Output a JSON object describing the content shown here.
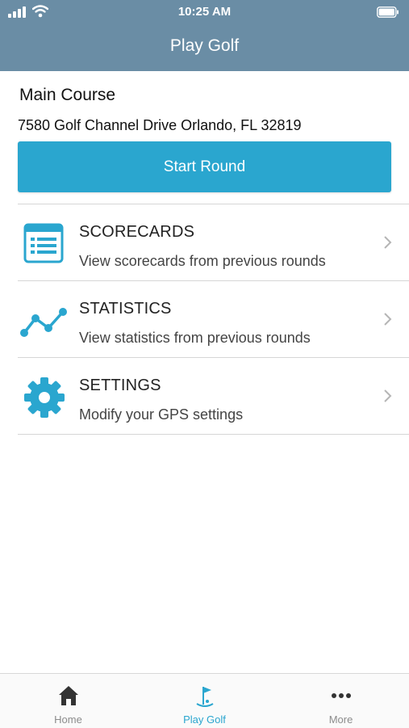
{
  "status_bar": {
    "time": "10:25 AM"
  },
  "header": {
    "title": "Play Golf"
  },
  "course": {
    "name": "Main Course",
    "address": "7580 Golf Channel Drive Orlando, FL 32819",
    "start_label": "Start Round"
  },
  "menu": [
    {
      "icon": "scorecard-icon",
      "title": "SCORECARDS",
      "subtitle": "View scorecards from previous rounds"
    },
    {
      "icon": "statistics-icon",
      "title": "STATISTICS",
      "subtitle": "View statistics from previous rounds"
    },
    {
      "icon": "gear-icon",
      "title": "SETTINGS",
      "subtitle": "Modify your GPS settings"
    }
  ],
  "tabs": [
    {
      "icon": "home-icon",
      "label": "Home",
      "active": false
    },
    {
      "icon": "golf-flag-icon",
      "label": "Play Golf",
      "active": true
    },
    {
      "icon": "more-icon",
      "label": "More",
      "active": false
    }
  ],
  "colors": {
    "header": "#6a8da5",
    "accent": "#2aa6cf",
    "tab_inactive": "#8c8c8c"
  }
}
